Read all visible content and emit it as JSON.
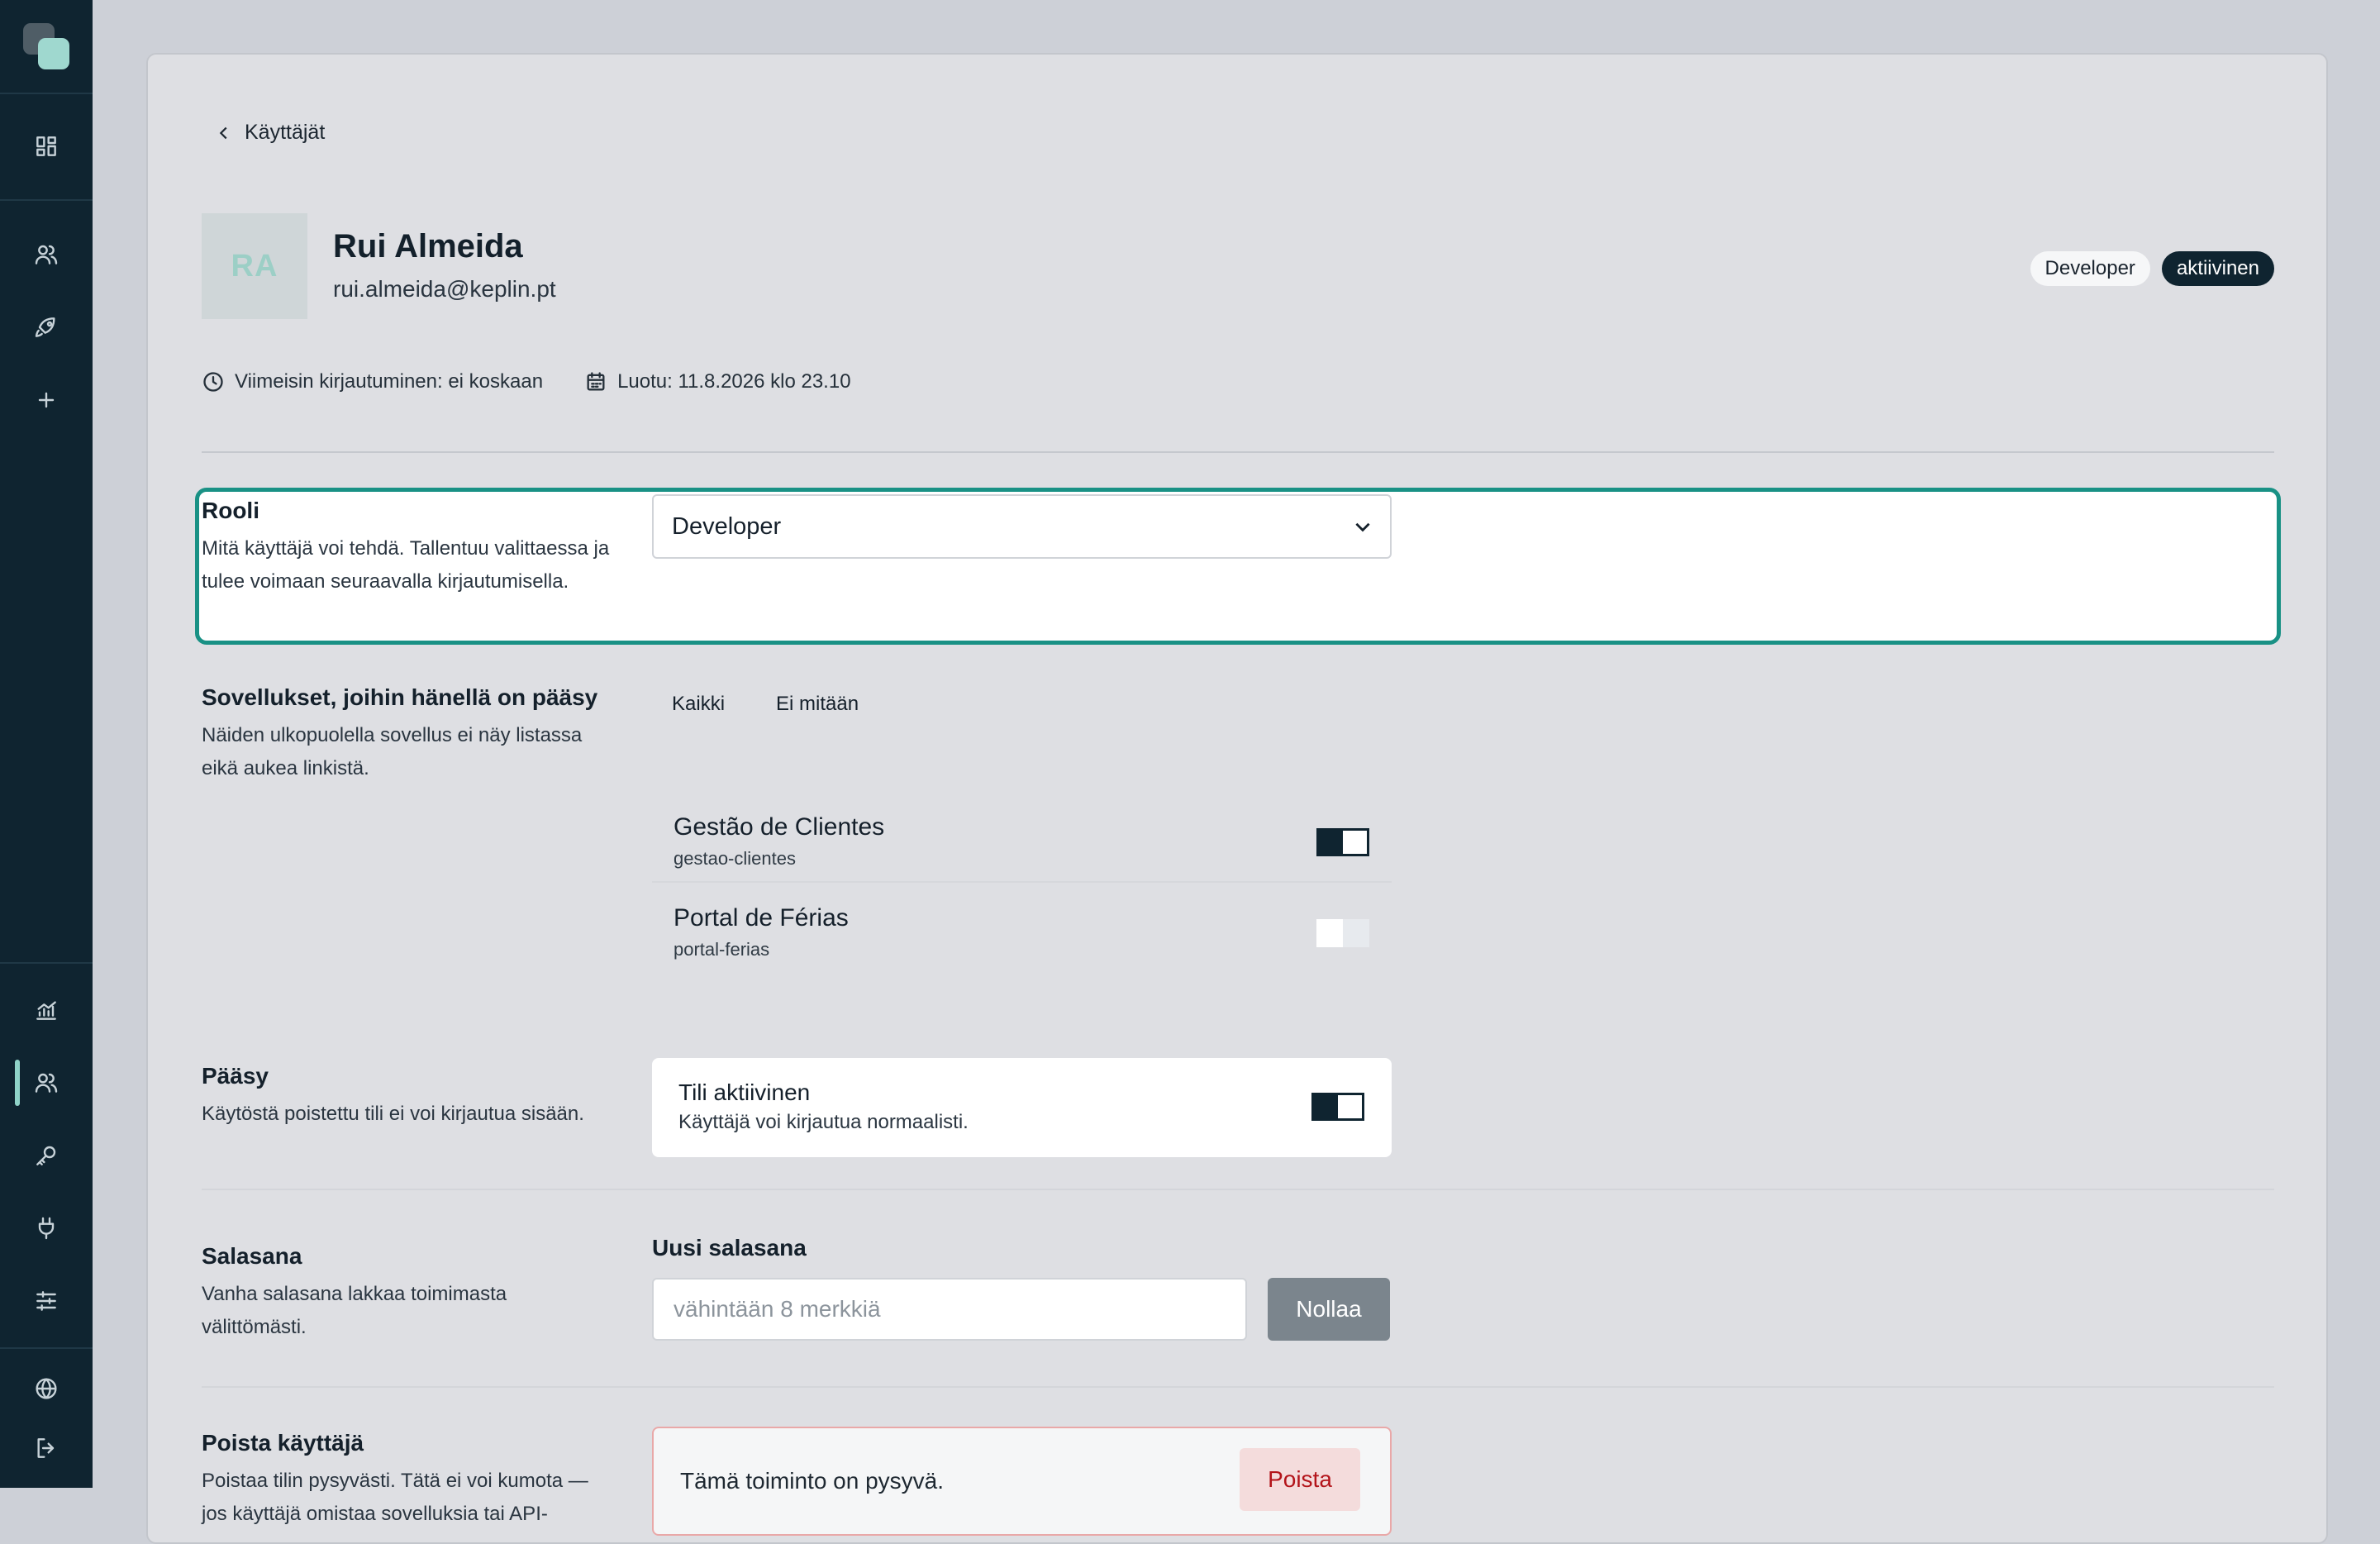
{
  "back_label": "Käyttäjät",
  "user": {
    "initials": "RA",
    "name": "Rui Almeida",
    "email": "rui.almeida@keplin.pt",
    "badges": {
      "role": "Developer",
      "status": "aktiivinen"
    },
    "last_login": "Viimeisin kirjautuminen: ei koskaan",
    "created": "Luotu: 11.8.2026 klo 23.10"
  },
  "sections": {
    "role": {
      "title": "Rooli",
      "description": "Mitä käyttäjä voi tehdä. Tallentuu valittaessa ja tulee voimaan seuraavalla kirjautumisella.",
      "selected": "Developer"
    },
    "apps": {
      "title": "Sovellukset, joihin hänellä on pääsy",
      "description": "Näiden ulkopuolella sovellus ei näy listassa eikä aukea linkistä.",
      "select_all": "Kaikki",
      "select_none": "Ei mitään",
      "items": [
        {
          "name": "Gestão de Clientes",
          "slug": "gestao-clientes",
          "enabled": true
        },
        {
          "name": "Portal de Férias",
          "slug": "portal-ferias",
          "enabled": false
        }
      ]
    },
    "access": {
      "title": "Pääsy",
      "description": "Käytöstä poistettu tili ei voi kirjautua sisään.",
      "toggle_title": "Tili aktiivinen",
      "toggle_desc": "Käyttäjä voi kirjautua normaalisti.",
      "enabled": true
    },
    "password": {
      "title": "Salasana",
      "description": "Vanha salasana lakkaa toimimasta välittömästi.",
      "field_label": "Uusi salasana",
      "placeholder": "vähintään 8 merkkiä",
      "button": "Nollaa"
    },
    "delete": {
      "title": "Poista käyttäjä",
      "description": "Poistaa tilin pysyvästi. Tätä ei voi kumota — jos käyttäjä omistaa sovelluksia tai API-",
      "warning": "Tämä toiminto on pysyvä.",
      "button": "Poista"
    }
  },
  "colors": {
    "sidebar_bg": "#0f2430",
    "accent_teal": "#199185",
    "danger_red": "#b3141a"
  },
  "sidebar_icons": [
    "dashboard-icon",
    "users-icon",
    "rocket-icon",
    "plus-icon",
    "chart-icon",
    "users-icon",
    "key-icon",
    "plug-icon",
    "sliders-icon",
    "globe-icon",
    "logout-icon"
  ]
}
